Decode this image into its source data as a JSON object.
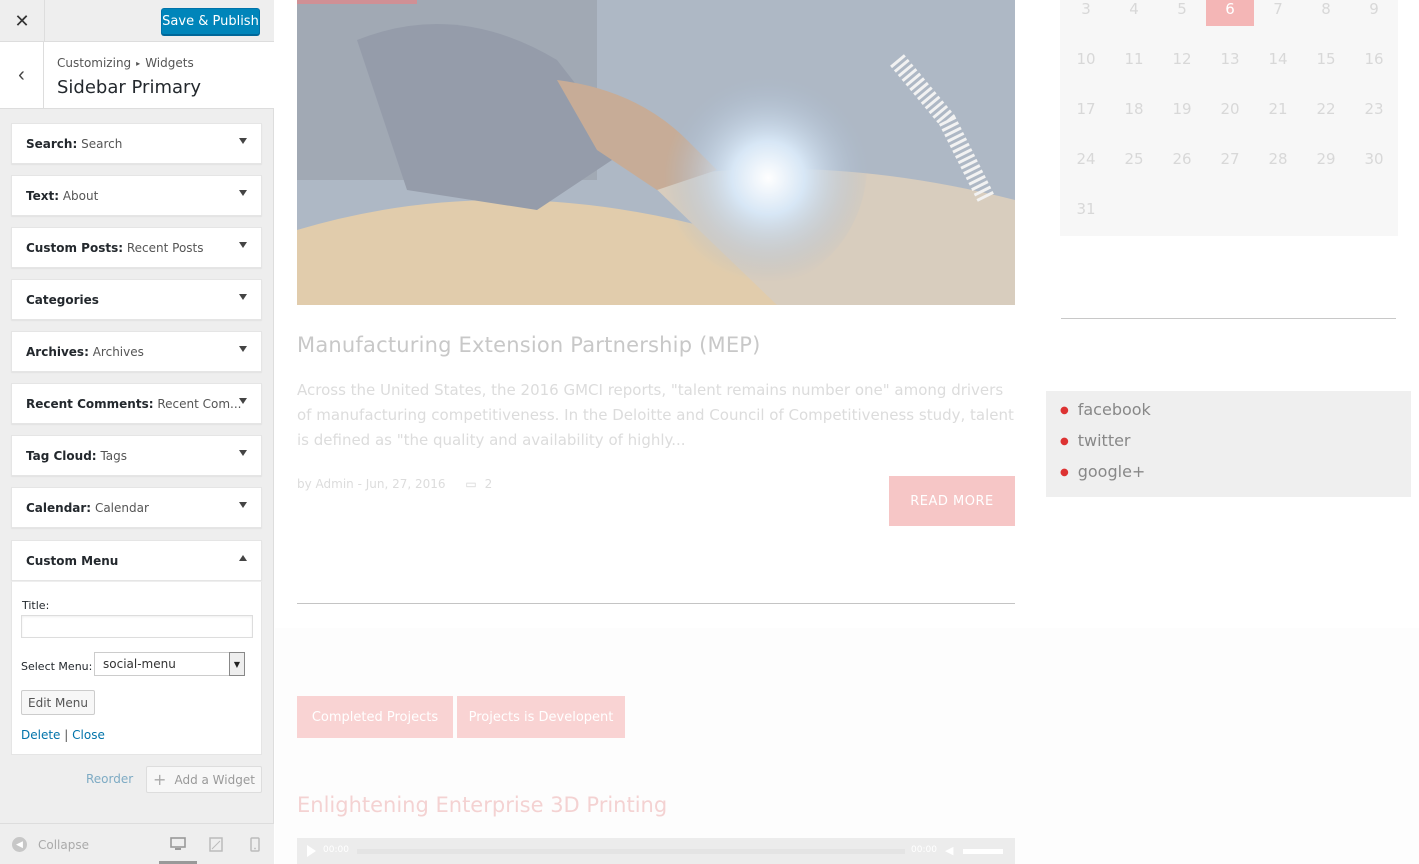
{
  "customizer": {
    "close_icon": "close-icon",
    "save_label": "Save & Publish",
    "breadcrumb": {
      "part1": "Customizing",
      "separator": "▸",
      "part2": "Widgets"
    },
    "section_title": "Sidebar Primary",
    "widgets": [
      {
        "type": "Search:",
        "title": "Search"
      },
      {
        "type": "Text:",
        "title": "About"
      },
      {
        "type": "Custom Posts:",
        "title": "Recent Posts"
      },
      {
        "type": "Categories",
        "title": ""
      },
      {
        "type": "Archives:",
        "title": "Archives"
      },
      {
        "type": "Recent Comments:",
        "title": "Recent Com..."
      },
      {
        "type": "Tag Cloud:",
        "title": "Tags"
      },
      {
        "type": "Calendar:",
        "title": "Calendar"
      },
      {
        "type": "Custom Menu",
        "title": ""
      }
    ],
    "custom_menu_form": {
      "title_label": "Title:",
      "title_value": "",
      "select_label": "Select Menu:",
      "select_value": "social-menu",
      "edit_menu_label": "Edit Menu",
      "delete_label": "Delete",
      "separator": "|",
      "close_label": "Close"
    },
    "reorder_label": "Reorder",
    "add_widget_label": "Add a Widget",
    "collapse_label": "Collapse"
  },
  "preview": {
    "post": {
      "title": "Manufacturing Extension Partnership (MEP)",
      "excerpt": "Across the United States, the 2016 GMCI reports, \"talent remains number one\" among drivers of manufacturing competitiveness. In the Deloitte and Council of Competitiveness study, talent is defined as \"the quality and availability of highly...",
      "meta": "by Admin - Jun, 27, 2016",
      "comments": "2",
      "read_more": "READ MORE"
    },
    "tabs": [
      "Completed Projects",
      "Projects is Developent"
    ],
    "post2_title": "Enlightening Enterprise 3D Printing",
    "audio": {
      "time_current": "00:00",
      "time_total": "00:00"
    },
    "calendar": {
      "rows": [
        [
          "3",
          "4",
          "5",
          "6",
          "7",
          "8",
          "9"
        ],
        [
          "10",
          "11",
          "12",
          "13",
          "14",
          "15",
          "16"
        ],
        [
          "17",
          "18",
          "19",
          "20",
          "21",
          "22",
          "23"
        ],
        [
          "24",
          "25",
          "26",
          "27",
          "28",
          "29",
          "30"
        ],
        [
          "31"
        ]
      ],
      "today": "6"
    },
    "social_menu": [
      "facebook",
      "twitter",
      "google+"
    ]
  },
  "colors": {
    "primary_button": "#0085ba",
    "accent": "#f4b6b6",
    "link": "#0073aa"
  }
}
